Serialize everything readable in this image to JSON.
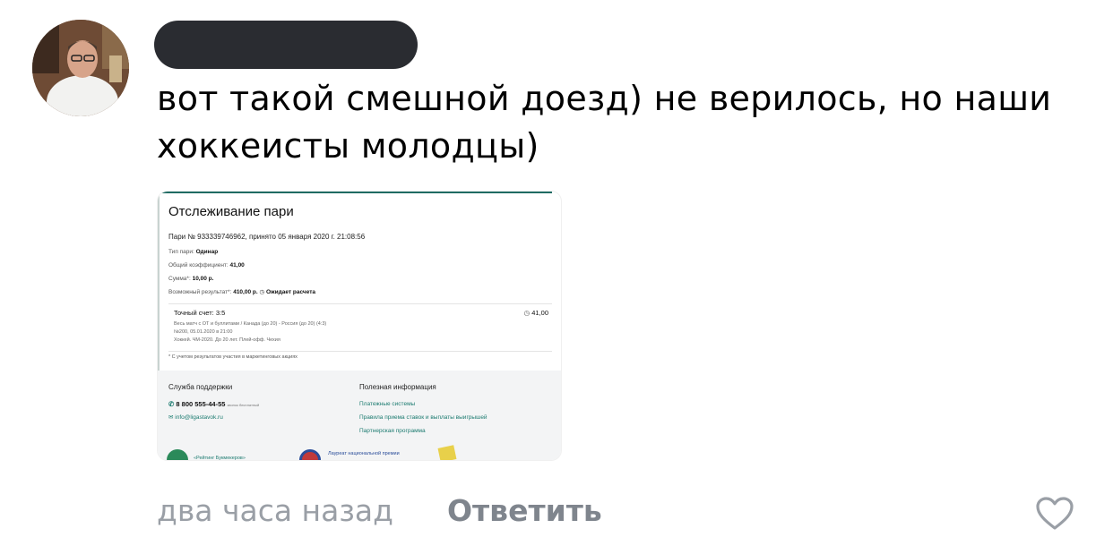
{
  "comment": {
    "text": "вот такой смешной доезд) не верилось, но наши хоккеисты молодцы)",
    "time": "два часа назад",
    "reply_label": "Ответить",
    "like_icon": "heart-outline-icon"
  },
  "attachment": {
    "title": "Отслеживание пари",
    "bet_line": "Пари № 933339746962, принято 05 января 2020 г. 21:08:56",
    "type_label": "Тип пари:",
    "type_value": "Одинар",
    "coef_label": "Общий коэффициент:",
    "coef_value": "41,00",
    "sum_label": "Сумма*:",
    "sum_value": "10,00 р.",
    "result_label": "Возможный результат*:",
    "result_value": "410,00 р.",
    "status": "Ожидает расчета",
    "event_title": "Точный счет: 3:5",
    "event_odds": "41,00",
    "event_line1": "Весь матч с ОТ и буллитами / Канада (до 20) - Россия (до 20) (4:3)",
    "event_line2": "№200, 05.01.2020 в 21:00",
    "event_line3": "Хоккей. ЧМ-2020. До 20 лет. Плей-офф. Чехия",
    "footnote": "* С учетом результатов участия в маркетинговых акциях",
    "support_title": "Служба поддержки",
    "phone": "8 800 555-44-55",
    "phone_note": "звонок бесплатный",
    "email": "info@ligastavok.ru",
    "info_title": "Полезная информация",
    "info_links": [
      "Платежные системы",
      "Правила приема ставок и выплаты выигрышей",
      "Партнерская программа"
    ],
    "rating_text": "«Рейтинг Букмекеров»",
    "laureate_text": "Лауреат национальной премии"
  },
  "colors": {
    "accent_green": "#1c7b70",
    "meta_gray": "#9a9fa6",
    "reply_gray": "#7f858d",
    "redacted": "#2a2c31"
  }
}
